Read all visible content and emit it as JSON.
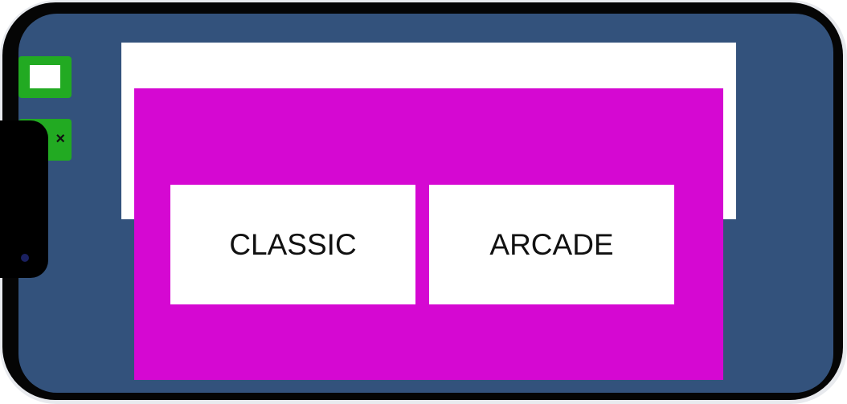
{
  "game_mode_menu": {
    "classic_label": "CLASSIC",
    "arcade_label": "ARCADE"
  },
  "side_buttons": {
    "close_label": "×"
  },
  "colors": {
    "background": "#33527c",
    "panel": "#d508d2",
    "side_button": "#22aa22"
  }
}
